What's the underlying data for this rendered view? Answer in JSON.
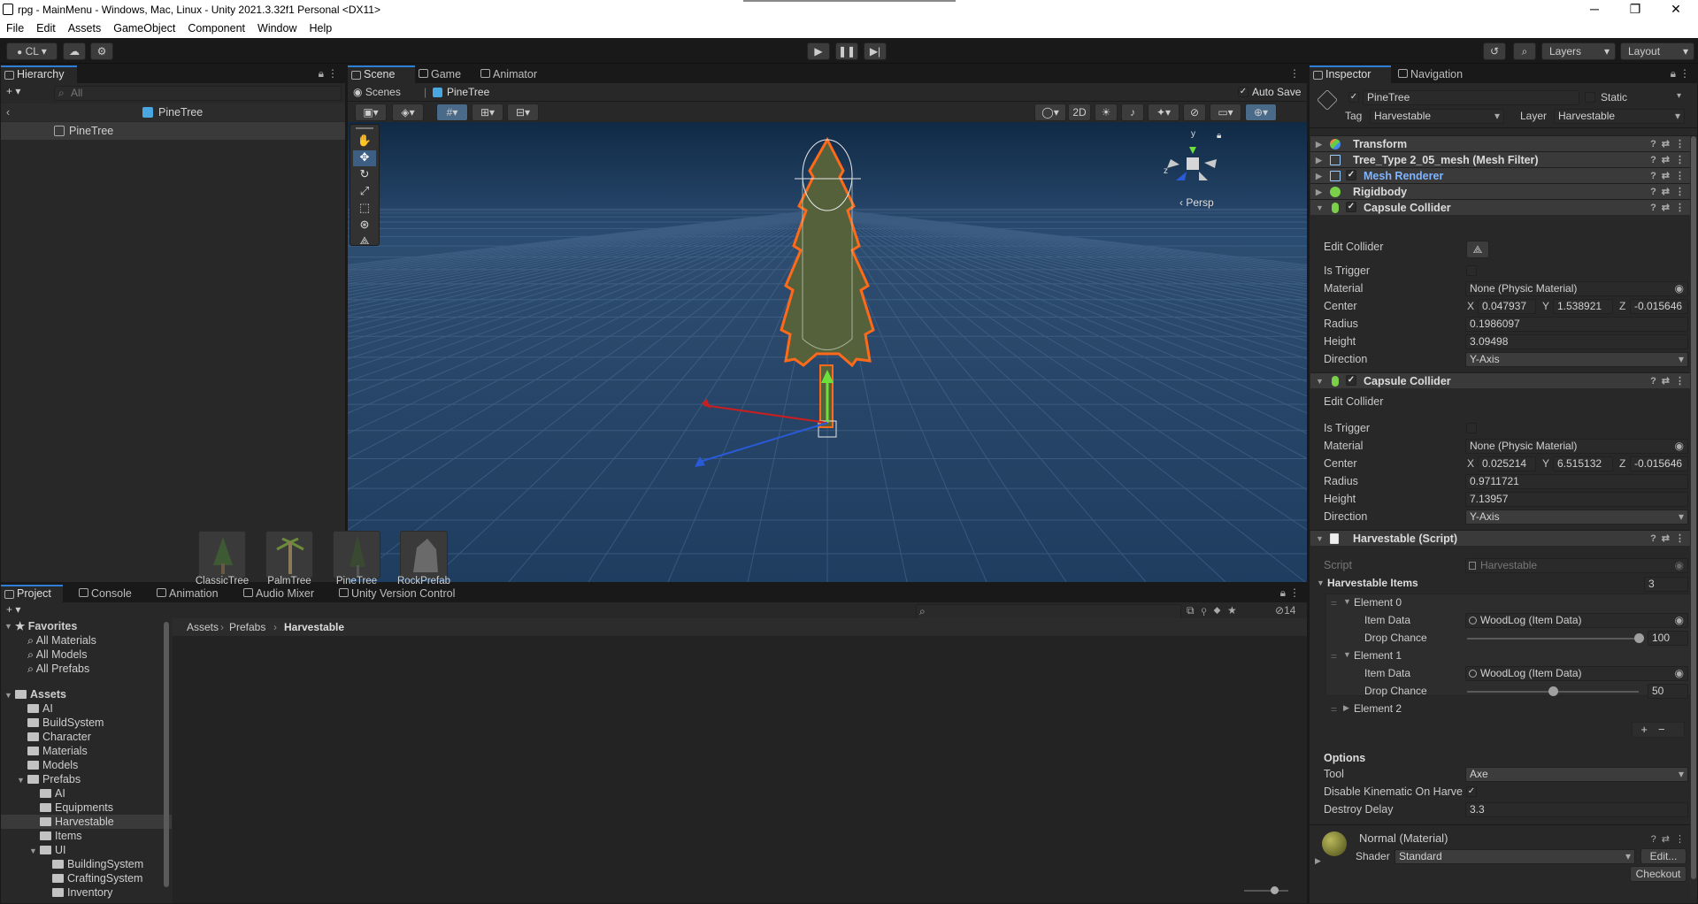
{
  "window": {
    "title": "rpg - MainMenu - Windows, Mac, Linux - Unity 2021.3.32f1 Personal <DX11>",
    "controls": [
      "─",
      "❐",
      "✕"
    ]
  },
  "menu": [
    "File",
    "Edit",
    "Assets",
    "GameObject",
    "Component",
    "Window",
    "Help"
  ],
  "toolbar": {
    "account": "CL",
    "layers": "Layers",
    "layout": "Layout"
  },
  "hierarchy": {
    "tab": "Hierarchy",
    "search_placeholder": "All",
    "root": "PineTree",
    "child": "PineTree"
  },
  "scene": {
    "tabs": [
      "Scene",
      "Game",
      "Animator"
    ],
    "breadcrumb_root": "Scenes",
    "breadcrumb_current": "PineTree",
    "auto_save": "Auto Save",
    "mode_2d": "2D",
    "persp": "Persp",
    "gizmo_axes": {
      "y": "y",
      "z": "z"
    }
  },
  "inspector": {
    "tabs": [
      "Inspector",
      "Navigation"
    ],
    "object_name": "PineTree",
    "static_label": "Static",
    "tag_label": "Tag",
    "tag_value": "Harvestable",
    "layer_label": "Layer",
    "layer_value": "Harvestable",
    "components": {
      "transform": "Transform",
      "mesh_filter": "Tree_Type 2_05_mesh (Mesh Filter)",
      "mesh_renderer": "Mesh Renderer",
      "rigidbody": "Rigidbody",
      "capsule1": "Capsule Collider",
      "capsule2": "Capsule Collider",
      "harvestable": "Harvestable (Script)"
    },
    "capsule1": {
      "edit_collider": "Edit Collider",
      "is_trigger": "Is Trigger",
      "material_label": "Material",
      "material": "None (Physic Material)",
      "center_label": "Center",
      "cx": "0.047937",
      "cy": "1.538921",
      "cz": "-0.015646",
      "radius_label": "Radius",
      "radius": "0.1986097",
      "height_label": "Height",
      "height": "3.09498",
      "direction_label": "Direction",
      "direction": "Y-Axis"
    },
    "capsule2": {
      "edit_collider": "Edit Collider",
      "is_trigger": "Is Trigger",
      "material_label": "Material",
      "material": "None (Physic Material)",
      "center_label": "Center",
      "cx": "0.025214",
      "cy": "6.515132",
      "cz": "-0.015646",
      "radius_label": "Radius",
      "radius": "0.9711721",
      "height_label": "Height",
      "height": "7.13957",
      "direction_label": "Direction",
      "direction": "Y-Axis"
    },
    "harvestable": {
      "script_label": "Script",
      "script": "Harvestable",
      "items_label": "Harvestable Items",
      "items_count": "3",
      "element0": "Element 0",
      "element1": "Element 1",
      "element2": "Element 2",
      "item_data_label": "Item Data",
      "drop_chance_label": "Drop Chance",
      "item0": "WoodLog (Item Data)",
      "chance0": "100",
      "chance0_fraction": 1.0,
      "item1": "WoodLog (Item Data)",
      "chance1": "50",
      "chance1_fraction": 0.5,
      "options_label": "Options",
      "tool_label": "Tool",
      "tool": "Axe",
      "disable_kinematic_label": "Disable Kinematic On Harve",
      "destroy_delay_label": "Destroy Delay",
      "destroy_delay": "3.3"
    },
    "material": {
      "name": "Normal (Material)",
      "shader_label": "Shader",
      "shader": "Standard",
      "edit": "Edit...",
      "checkout": "Checkout"
    }
  },
  "project": {
    "tabs": [
      "Project",
      "Console",
      "Animation",
      "Audio Mixer",
      "Unity Version Control"
    ],
    "hidden_count": "14",
    "favorites": "Favorites",
    "fav_items": [
      "All Materials",
      "All Models",
      "All Prefabs"
    ],
    "assets": "Assets",
    "asset_folders": [
      "AI",
      "BuildSystem",
      "Character",
      "Materials",
      "Models",
      "Prefabs"
    ],
    "prefab_folders": [
      "AI",
      "Equipments",
      "Harvestable",
      "Items",
      "UI"
    ],
    "ui_folders": [
      "BuildingSystem",
      "CraftingSystem",
      "Inventory"
    ],
    "breadcrumb": [
      "Assets",
      "Prefabs",
      "Harvestable"
    ],
    "files": [
      "ClassicTree",
      "PalmTree",
      "PineTree",
      "RockPrefab"
    ]
  },
  "colors": {
    "accent": "#2f7ed8",
    "selection_orange": "#ff6a1a",
    "scene_sky": "#2b4c72",
    "scene_ground": "#1f3d5f"
  }
}
